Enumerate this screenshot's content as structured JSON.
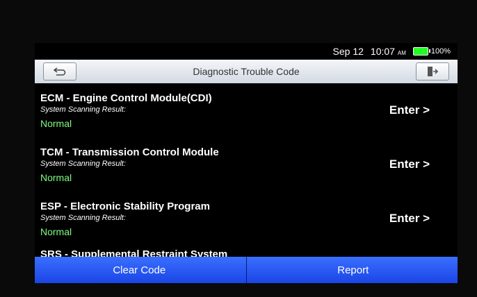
{
  "status": {
    "date": "Sep 12",
    "time": "10:07",
    "ampm": "AM",
    "battery": "100%"
  },
  "header": {
    "title": "Diagnostic Trouble Code",
    "back_icon": "back-arrow-icon",
    "exit_icon": "exit-icon"
  },
  "modules": [
    {
      "title": "ECM - Engine Control Module(CDI)",
      "label": "System Scanning Result:",
      "result": "Normal",
      "action": "Enter >"
    },
    {
      "title": "TCM - Transmission Control Module",
      "label": "System Scanning Result:",
      "result": "Normal",
      "action": "Enter >"
    },
    {
      "title": "ESP - Electronic Stability Program",
      "label": "System Scanning Result:",
      "result": "Normal",
      "action": "Enter >"
    },
    {
      "title": "SRS - Supplemental Restraint System"
    }
  ],
  "footer": {
    "clear_label": "Clear Code",
    "report_label": "Report"
  },
  "colors": {
    "result_normal": "#7dff7d",
    "button_blue": "#2a5bff"
  }
}
